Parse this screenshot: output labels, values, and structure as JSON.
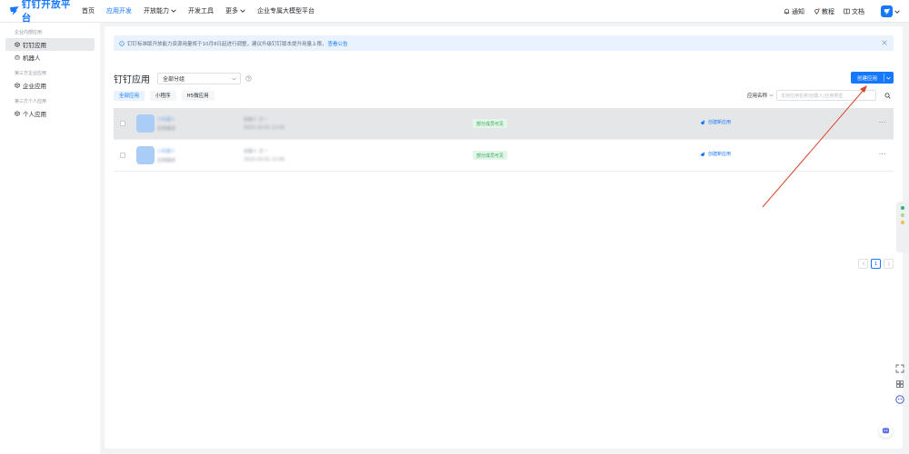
{
  "brand": {
    "name": "钉钉开放平台",
    "color": "#1677ff"
  },
  "topnav": [
    {
      "label": "首页",
      "active": false,
      "dropdown": false
    },
    {
      "label": "应用开发",
      "active": true,
      "dropdown": false
    },
    {
      "label": "开放能力",
      "active": false,
      "dropdown": true
    },
    {
      "label": "开发工具",
      "active": false,
      "dropdown": false
    },
    {
      "label": "更多",
      "active": false,
      "dropdown": true
    },
    {
      "label": "企业专属大模型平台",
      "active": false,
      "dropdown": false
    }
  ],
  "topright": {
    "notifications": "通知",
    "tutorial": "教程",
    "docs": "文档"
  },
  "sidebar": {
    "sections": [
      {
        "title": "企业内部应用",
        "items": [
          {
            "label": "钉钉应用",
            "icon": "cube-icon",
            "active": true
          },
          {
            "label": "机器人",
            "icon": "robot-icon",
            "active": false
          }
        ]
      },
      {
        "title": "第三方企业应用",
        "items": [
          {
            "label": "企业应用",
            "icon": "cube-icon",
            "active": false
          }
        ]
      },
      {
        "title": "第三方个人应用",
        "items": [
          {
            "label": "个人应用",
            "icon": "cube-icon",
            "active": false
          }
        ]
      }
    ]
  },
  "notice": {
    "text": "钉钉标准版开放能力资源用量将于10月8日起进行调整，建议升级钉钉版本提升用量上限，",
    "link": "查看公告"
  },
  "page": {
    "title": "钉钉应用",
    "group_select": "全部分组",
    "create_button": "创建应用"
  },
  "tabs": [
    {
      "label": "全部应用",
      "active": true
    },
    {
      "label": "小程序",
      "active": false
    },
    {
      "label": "H5微应用",
      "active": false
    }
  ],
  "filter": {
    "label": "应用名称",
    "placeholder": "支持应用名称/创建人/应用类型"
  },
  "rows": [
    {
      "name": "小机器人",
      "subtitle": "应用描述",
      "owner_a": "创建人 王一",
      "owner_b": "2023-10-01 12:00",
      "visibility": "部分成员可见",
      "action": "创建新应用",
      "hover": true
    },
    {
      "name": "小机器人",
      "subtitle": "应用描述",
      "owner_a": "创建人 王一",
      "owner_b": "2023-10-01 12:00",
      "visibility": "部分成员可见",
      "action": "创建新应用",
      "hover": false
    }
  ],
  "row_more": "···",
  "pagination": {
    "current": "1"
  },
  "colors": {
    "accent": "#1677ff",
    "visible_tag_bg": "#e3f6e9",
    "visible_tag_text": "#34a853",
    "annotation_arrow": "#d9472b"
  }
}
